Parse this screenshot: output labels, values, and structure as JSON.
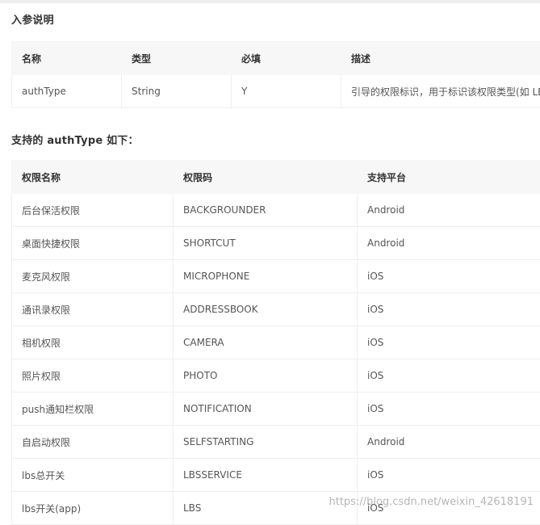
{
  "input_params": {
    "title": "入参说明",
    "headers": [
      "名称",
      "类型",
      "必填",
      "描述"
    ],
    "rows": [
      [
        "authType",
        "String",
        "Y",
        "引导的权限标识，用于标识该权限类型(如 LB"
      ]
    ]
  },
  "auth_types": {
    "title": "支持的 authType 如下：",
    "headers": [
      "权限名称",
      "权限码",
      "支持平台"
    ],
    "rows": [
      [
        "后台保活权限",
        "BACKGROUNDER",
        "Android"
      ],
      [
        "桌面快捷权限",
        "SHORTCUT",
        "Android"
      ],
      [
        "麦克风权限",
        "MICROPHONE",
        "iOS"
      ],
      [
        "通讯录权限",
        "ADDRESSBOOK",
        "iOS"
      ],
      [
        "相机权限",
        "CAMERA",
        "iOS"
      ],
      [
        "照片权限",
        "PHOTO",
        "iOS"
      ],
      [
        "push通知栏权限",
        "NOTIFICATION",
        "iOS"
      ],
      [
        "自启动权限",
        "SELFSTARTING",
        "Android"
      ],
      [
        "lbs总开关",
        "LBSSERVICE",
        "iOS"
      ],
      [
        "lbs开关(app)",
        "LBS",
        "iOS"
      ]
    ]
  },
  "watermark": "https://blog.csdn.net/weixin_42618191"
}
